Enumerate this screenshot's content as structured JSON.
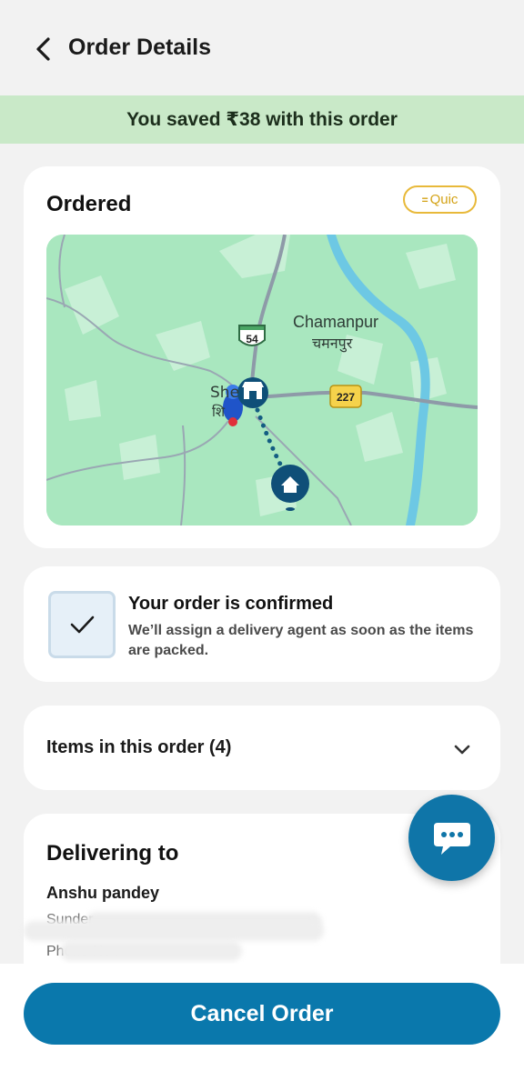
{
  "header": {
    "title": "Order Details",
    "back_icon": "chevron-left-icon"
  },
  "savings_banner": {
    "text": "You saved ₹38 with this order",
    "color": "#c9e9c8"
  },
  "order_status": {
    "title": "Ordered",
    "badge": "Quic",
    "map": {
      "place_name": "Chamanpur",
      "place_name_hindi": "चमनपुर",
      "town_label": "She",
      "town_label_hindi": "शि",
      "highway_54": "54",
      "highway_227": "227",
      "icons": [
        "scooter-icon",
        "store-icon",
        "home-icon"
      ]
    }
  },
  "confirmation": {
    "title": "Your order is confirmed",
    "message": "We’ll assign a delivery agent as soon as the items are packed.",
    "icon": "checkmark-icon"
  },
  "items_section": {
    "label": "Items in this order (4)",
    "icon": "chevron-down-icon"
  },
  "delivery": {
    "title": "Delivering to",
    "name": "Anshu pandey",
    "address_visible": "Sunder",
    "phone_visible": "Phone No : "
  },
  "chat_button": {
    "icon": "chat-bubble-icon",
    "color": "#0f75a8"
  },
  "actions": {
    "cancel_label": "Cancel Order",
    "accent": "#0a78ac"
  }
}
